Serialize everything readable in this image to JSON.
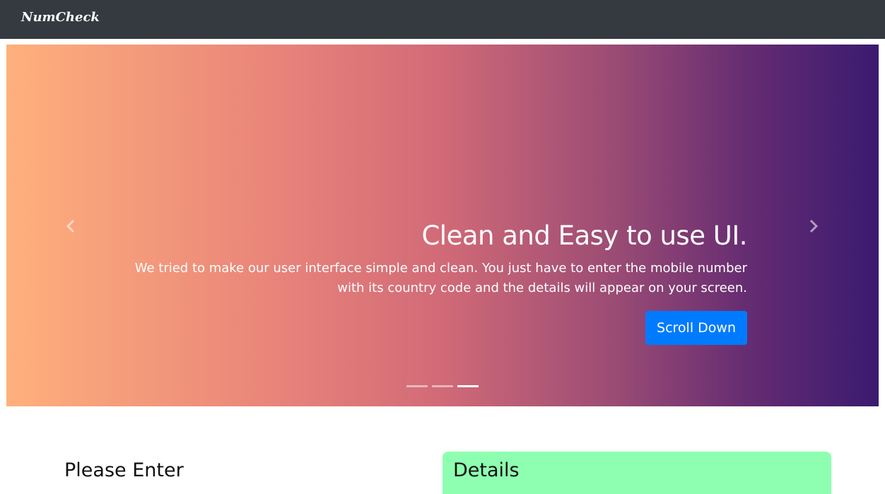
{
  "navbar": {
    "brand": "NumCheck"
  },
  "carousel": {
    "title": "Clean and Easy to use UI.",
    "text": "We tried to make our user interface simple and clean. You just have to enter the mobile number with its country code and the details will appear on your screen.",
    "button_label": "Scroll Down",
    "prev_icon": "chevron-left-icon",
    "next_icon": "chevron-right-icon",
    "slide_count": 3,
    "active_slide": 3,
    "colors": {
      "gradient_start": "#ffb07c",
      "gradient_end": "#3b1a70",
      "button": "#007bff"
    }
  },
  "form": {
    "heading": "Please Enter"
  },
  "details": {
    "heading": "Details",
    "background": "#8effb0"
  }
}
